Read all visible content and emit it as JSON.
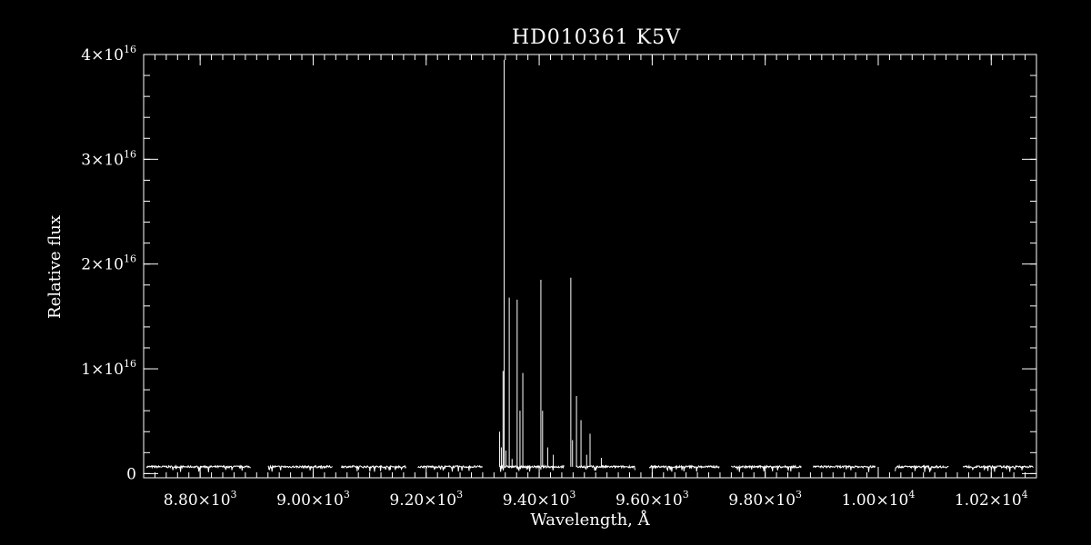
{
  "chart_data": {
    "type": "line",
    "title": "HD010361  K5V",
    "xlabel": "Wavelength, Å",
    "ylabel": "Relative flux",
    "xlim": [
      8700,
      10280
    ],
    "ylim": [
      -400000000000000.0,
      4e+16
    ],
    "grid": false,
    "x_ticks": [
      {
        "value": 8800,
        "mantissa": "8.80",
        "exponent": "3"
      },
      {
        "value": 9000,
        "mantissa": "9.00",
        "exponent": "3"
      },
      {
        "value": 9200,
        "mantissa": "9.20",
        "exponent": "3"
      },
      {
        "value": 9400,
        "mantissa": "9.40",
        "exponent": "3"
      },
      {
        "value": 9600,
        "mantissa": "9.60",
        "exponent": "3"
      },
      {
        "value": 9800,
        "mantissa": "9.80",
        "exponent": "3"
      },
      {
        "value": 10000,
        "mantissa": "1.00",
        "exponent": "4"
      },
      {
        "value": 10200,
        "mantissa": "1.02",
        "exponent": "4"
      }
    ],
    "y_ticks": [
      {
        "value": 0,
        "mantissa": "0",
        "exponent": ""
      },
      {
        "value": 1e+16,
        "mantissa": "1",
        "exponent": "16"
      },
      {
        "value": 2e+16,
        "mantissa": "2",
        "exponent": "16"
      },
      {
        "value": 3e+16,
        "mantissa": "3",
        "exponent": "16"
      },
      {
        "value": 4e+16,
        "mantissa": "4",
        "exponent": "16"
      }
    ],
    "continuum_level": 650000000000000.0,
    "continuum_segments": [
      [
        8705,
        8890
      ],
      [
        8920,
        9035
      ],
      [
        9050,
        9165
      ],
      [
        9185,
        9300
      ],
      [
        9330,
        9445
      ],
      [
        9465,
        9570
      ],
      [
        9595,
        9720
      ],
      [
        9740,
        9865
      ],
      [
        9885,
        9995
      ],
      [
        10030,
        10125
      ],
      [
        10150,
        10275
      ]
    ],
    "series": [
      {
        "points": [
          [
            9330,
            4000000000000000.0
          ],
          [
            9333,
            2500000000000000.0
          ],
          [
            9336,
            9800000000000000.0
          ],
          [
            9338,
            3.95e+16
          ],
          [
            9341,
            2200000000000000.0
          ],
          [
            9347,
            1.68e+16
          ],
          [
            9352,
            1400000000000000.0
          ],
          [
            9361,
            1.66e+16
          ],
          [
            9366,
            6000000000000000.0
          ],
          [
            9371,
            9600000000000000.0
          ],
          [
            9403,
            1.85e+16
          ],
          [
            9406,
            6000000000000000.0
          ],
          [
            9415,
            2500000000000000.0
          ],
          [
            9425,
            1800000000000000.0
          ],
          [
            9456,
            1.87e+16
          ],
          [
            9459,
            3200000000000000.0
          ],
          [
            9466,
            7400000000000000.0
          ],
          [
            9474,
            5100000000000000.0
          ],
          [
            9484,
            1800000000000000.0
          ],
          [
            9490,
            3800000000000000.0
          ],
          [
            9510,
            1500000000000000.0
          ]
        ]
      }
    ]
  }
}
